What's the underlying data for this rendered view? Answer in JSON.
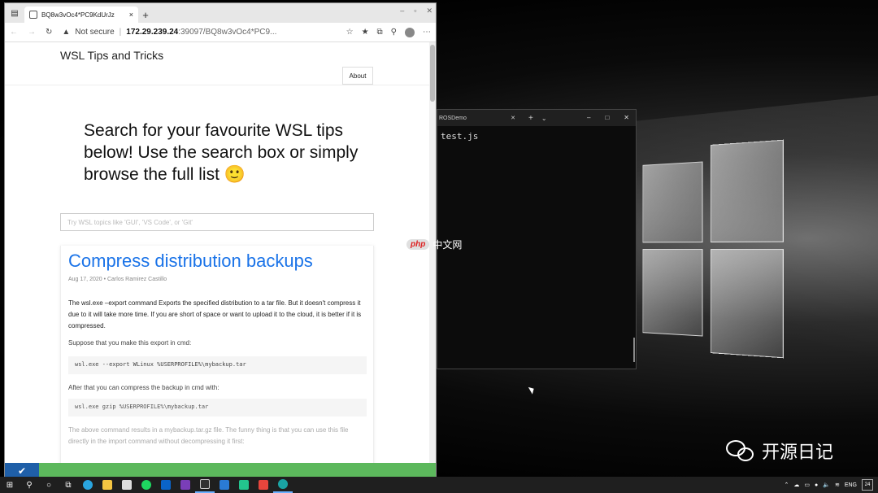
{
  "browser": {
    "tab_title": "BQ8w3vOc4*PC9KdUrJz",
    "tab_close": "×",
    "new_tab": "+",
    "security_label": "Not secure",
    "url_host": "172.29.239.24",
    "url_rest": ":39097/BQ8w3vOc4*PC9...",
    "win_minimize": "–",
    "win_maximize": "▫",
    "win_close": "✕"
  },
  "site": {
    "title": "WSL Tips and Tricks",
    "nav_about": "About",
    "hero_text": "Search for your favourite WSL tips below! Use the search box or simply browse the full list 🙂",
    "search_placeholder": "Try WSL topics like 'GUI', 'VS Code', or 'Git'"
  },
  "post": {
    "title": "Compress distribution backups",
    "meta": "Aug 17, 2020 • Carlos Ramirez Castillo",
    "para1": "The wsl.exe –export command Exports the specified distribution to a tar file. But it doesn't compress it due to it will take more time. If you are short of space or want to upload it to the cloud, it is better if it is compressed.",
    "para2": "Suppose that you make this export in cmd:",
    "code1": "wsl.exe --export WLinux %USERPROFILE%\\mybackup.tar",
    "para3": "After that you can compress the backup in cmd with:",
    "code2": "wsl.exe gzip %USERPROFILE%\\mybackup.tar",
    "para4": "The above command results in a mybackup.tar.gz file. The funny thing is that you can use this file directly in the import command without decompressing it first:"
  },
  "terminal": {
    "tab_title": "ROSDemo",
    "tab_close": "✕",
    "new_tab": "+",
    "dropdown": "⌄",
    "minimize": "–",
    "maximize": "□",
    "close": "✕",
    "line1": "test.js"
  },
  "watermarks": {
    "php_logo": "php",
    "php_site": "中文网",
    "wechat_account": "开源日记"
  },
  "taskbar": {
    "language": "ENG",
    "notification_count": "24"
  },
  "colors": {
    "link_blue": "#1a73e8",
    "notification_green": "#5cb85c"
  }
}
